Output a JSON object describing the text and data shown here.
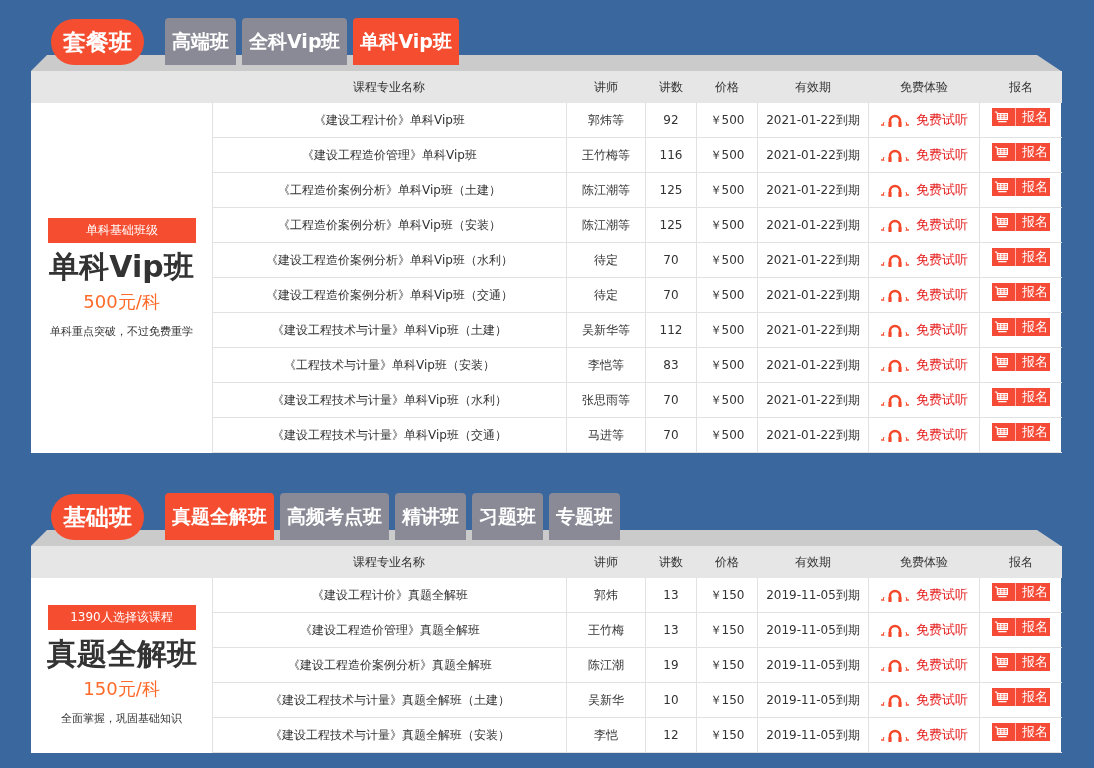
{
  "sections": [
    {
      "title": "套餐班",
      "tabs": [
        {
          "label": "高端班",
          "selected": false
        },
        {
          "label": "全科Vip班",
          "selected": false
        },
        {
          "label": "单科Vip班",
          "selected": true
        }
      ],
      "columns": [
        "课程专业名称",
        "讲师",
        "讲数",
        "价格",
        "有效期",
        "免费体验",
        "报名"
      ],
      "promo": {
        "badge": "单科基础班级",
        "name": "单科Vip班",
        "price": "500元/科",
        "note": "单科重点突破，不过免费重学"
      },
      "rows": [
        {
          "course": "《建设工程计价》单科Vip班",
          "teacher": "郭炜等",
          "lessons": "92",
          "price": "￥500",
          "expiry": "2021-01-22到期",
          "trial": "免费试听",
          "signup": "报名"
        },
        {
          "course": "《建设工程造价管理》单科Vip班",
          "teacher": "王竹梅等",
          "lessons": "116",
          "price": "￥500",
          "expiry": "2021-01-22到期",
          "trial": "免费试听",
          "signup": "报名"
        },
        {
          "course": "《工程造价案例分析》单科Vip班（土建）",
          "teacher": "陈江潮等",
          "lessons": "125",
          "price": "￥500",
          "expiry": "2021-01-22到期",
          "trial": "免费试听",
          "signup": "报名"
        },
        {
          "course": "《工程造价案例分析》单科Vip班（安装）",
          "teacher": "陈江潮等",
          "lessons": "125",
          "price": "￥500",
          "expiry": "2021-01-22到期",
          "trial": "免费试听",
          "signup": "报名"
        },
        {
          "course": "《建设工程造价案例分析》单科Vip班（水利）",
          "teacher": "待定",
          "lessons": "70",
          "price": "￥500",
          "expiry": "2021-01-22到期",
          "trial": "免费试听",
          "signup": "报名"
        },
        {
          "course": "《建设工程造价案例分析》单科Vip班（交通）",
          "teacher": "待定",
          "lessons": "70",
          "price": "￥500",
          "expiry": "2021-01-22到期",
          "trial": "免费试听",
          "signup": "报名"
        },
        {
          "course": "《建设工程技术与计量》单科Vip班（土建）",
          "teacher": "吴新华等",
          "lessons": "112",
          "price": "￥500",
          "expiry": "2021-01-22到期",
          "trial": "免费试听",
          "signup": "报名"
        },
        {
          "course": "《工程技术与计量》单科Vip班（安装）",
          "teacher": "李恺等",
          "lessons": "83",
          "price": "￥500",
          "expiry": "2021-01-22到期",
          "trial": "免费试听",
          "signup": "报名"
        },
        {
          "course": "《建设工程技术与计量》单科Vip班（水利）",
          "teacher": "张思雨等",
          "lessons": "70",
          "price": "￥500",
          "expiry": "2021-01-22到期",
          "trial": "免费试听",
          "signup": "报名"
        },
        {
          "course": "《建设工程技术与计量》单科Vip班（交通）",
          "teacher": "马进等",
          "lessons": "70",
          "price": "￥500",
          "expiry": "2021-01-22到期",
          "trial": "免费试听",
          "signup": "报名"
        }
      ]
    },
    {
      "title": "基础班",
      "tabs": [
        {
          "label": "真题全解班",
          "selected": true
        },
        {
          "label": "高频考点班",
          "selected": false
        },
        {
          "label": "精讲班",
          "selected": false
        },
        {
          "label": "习题班",
          "selected": false
        },
        {
          "label": "专题班",
          "selected": false
        }
      ],
      "columns": [
        "课程专业名称",
        "讲师",
        "讲数",
        "价格",
        "有效期",
        "免费体验",
        "报名"
      ],
      "promo": {
        "badge": "1390人选择该课程",
        "name": "真题全解班",
        "price": "150元/科",
        "note": "全面掌握，巩固基础知识"
      },
      "rows": [
        {
          "course": "《建设工程计价》真题全解班",
          "teacher": "郭炜",
          "lessons": "13",
          "price": "￥150",
          "expiry": "2019-11-05到期",
          "trial": "免费试听",
          "signup": "报名"
        },
        {
          "course": "《建设工程造价管理》真题全解班",
          "teacher": "王竹梅",
          "lessons": "13",
          "price": "￥150",
          "expiry": "2019-11-05到期",
          "trial": "免费试听",
          "signup": "报名"
        },
        {
          "course": "《建设工程造价案例分析》真题全解班",
          "teacher": "陈江潮",
          "lessons": "19",
          "price": "￥150",
          "expiry": "2019-11-05到期",
          "trial": "免费试听",
          "signup": "报名"
        },
        {
          "course": "《建设工程技术与计量》真题全解班（土建）",
          "teacher": "吴新华",
          "lessons": "10",
          "price": "￥150",
          "expiry": "2019-11-05到期",
          "trial": "免费试听",
          "signup": "报名"
        },
        {
          "course": "《建设工程技术与计量》真题全解班（安装）",
          "teacher": "李恺",
          "lessons": "12",
          "price": "￥150",
          "expiry": "2019-11-05到期",
          "trial": "免费试听",
          "signup": "报名"
        }
      ]
    }
  ]
}
